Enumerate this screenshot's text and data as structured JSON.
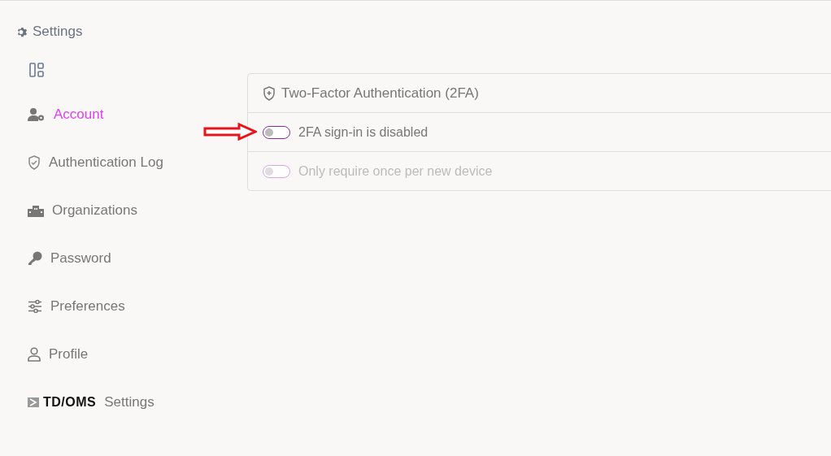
{
  "header": {
    "title": "Settings"
  },
  "sidebar": {
    "items": [
      {
        "kind": "user-gear",
        "label": "Account",
        "selected": true
      },
      {
        "kind": "shield",
        "label": "Authentication Log",
        "selected": false
      },
      {
        "kind": "buildings",
        "label": "Organizations",
        "selected": false
      },
      {
        "kind": "key",
        "label": "Password",
        "selected": false
      },
      {
        "kind": "sliders",
        "label": "Preferences",
        "selected": false
      },
      {
        "kind": "person",
        "label": "Profile",
        "selected": false
      },
      {
        "kind": "logo",
        "logo_text": "TD/OMS",
        "label": "Settings",
        "selected": false
      }
    ]
  },
  "panel": {
    "title": "Two-Factor Authentication (2FA)",
    "toggles": [
      {
        "label": "2FA sign-in is disabled",
        "on": false,
        "disabled": false,
        "pointed": true
      },
      {
        "label": "Only require once per new device",
        "on": false,
        "disabled": true,
        "pointed": false
      }
    ]
  }
}
